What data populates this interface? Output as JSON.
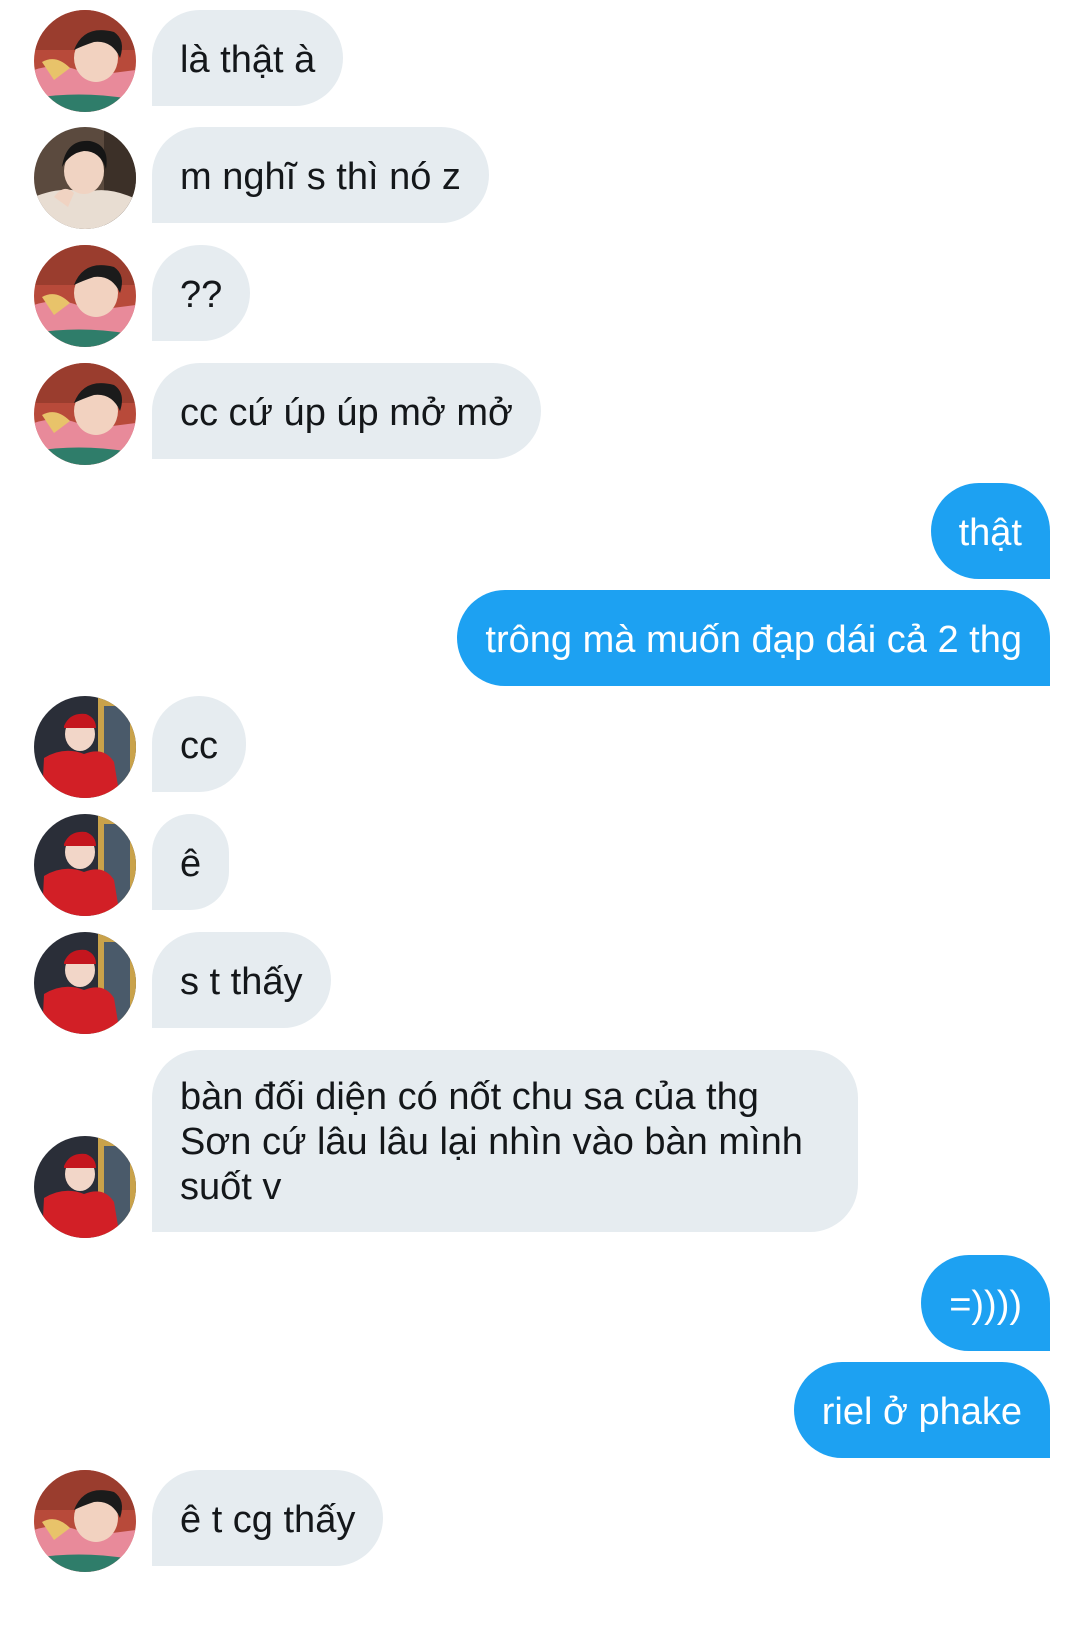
{
  "conversation": {
    "messages": [
      {
        "side": "in",
        "avatar": "pink-shirt-user-avatar",
        "text": "là thật à"
      },
      {
        "side": "in",
        "avatar": "jacket-user-avatar",
        "text": "m nghĩ s thì nó z"
      },
      {
        "side": "in",
        "avatar": "pink-shirt-user-avatar",
        "text": "??"
      },
      {
        "side": "in",
        "avatar": "pink-shirt-user-avatar",
        "text": "cc cứ úp úp mở mở"
      },
      {
        "side": "out",
        "text": "thật"
      },
      {
        "side": "out",
        "text": "trông mà muốn đạp dái cả 2 thg"
      },
      {
        "side": "in",
        "avatar": "red-coat-user-avatar",
        "text": "cc"
      },
      {
        "side": "in",
        "avatar": "red-coat-user-avatar",
        "text": "ê"
      },
      {
        "side": "in",
        "avatar": "red-coat-user-avatar",
        "text": "s t thấy"
      },
      {
        "side": "in",
        "avatar": "red-coat-user-avatar",
        "lines": [
          "bàn đối diện có nốt chu sa của thg",
          "Sơn cứ lâu lâu lại nhìn vào bàn mình",
          "suốt v"
        ]
      },
      {
        "side": "out",
        "text": "=))))"
      },
      {
        "side": "out",
        "text": "riel ở phake"
      },
      {
        "side": "in",
        "avatar": "pink-shirt-user-avatar",
        "text": "ê t cg thấy"
      }
    ]
  },
  "colors": {
    "incoming_bubble": "#e6ecf0",
    "outgoing_bubble": "#1da1f2",
    "incoming_text": "#14171a",
    "outgoing_text": "#ffffff",
    "background": "#ffffff"
  }
}
